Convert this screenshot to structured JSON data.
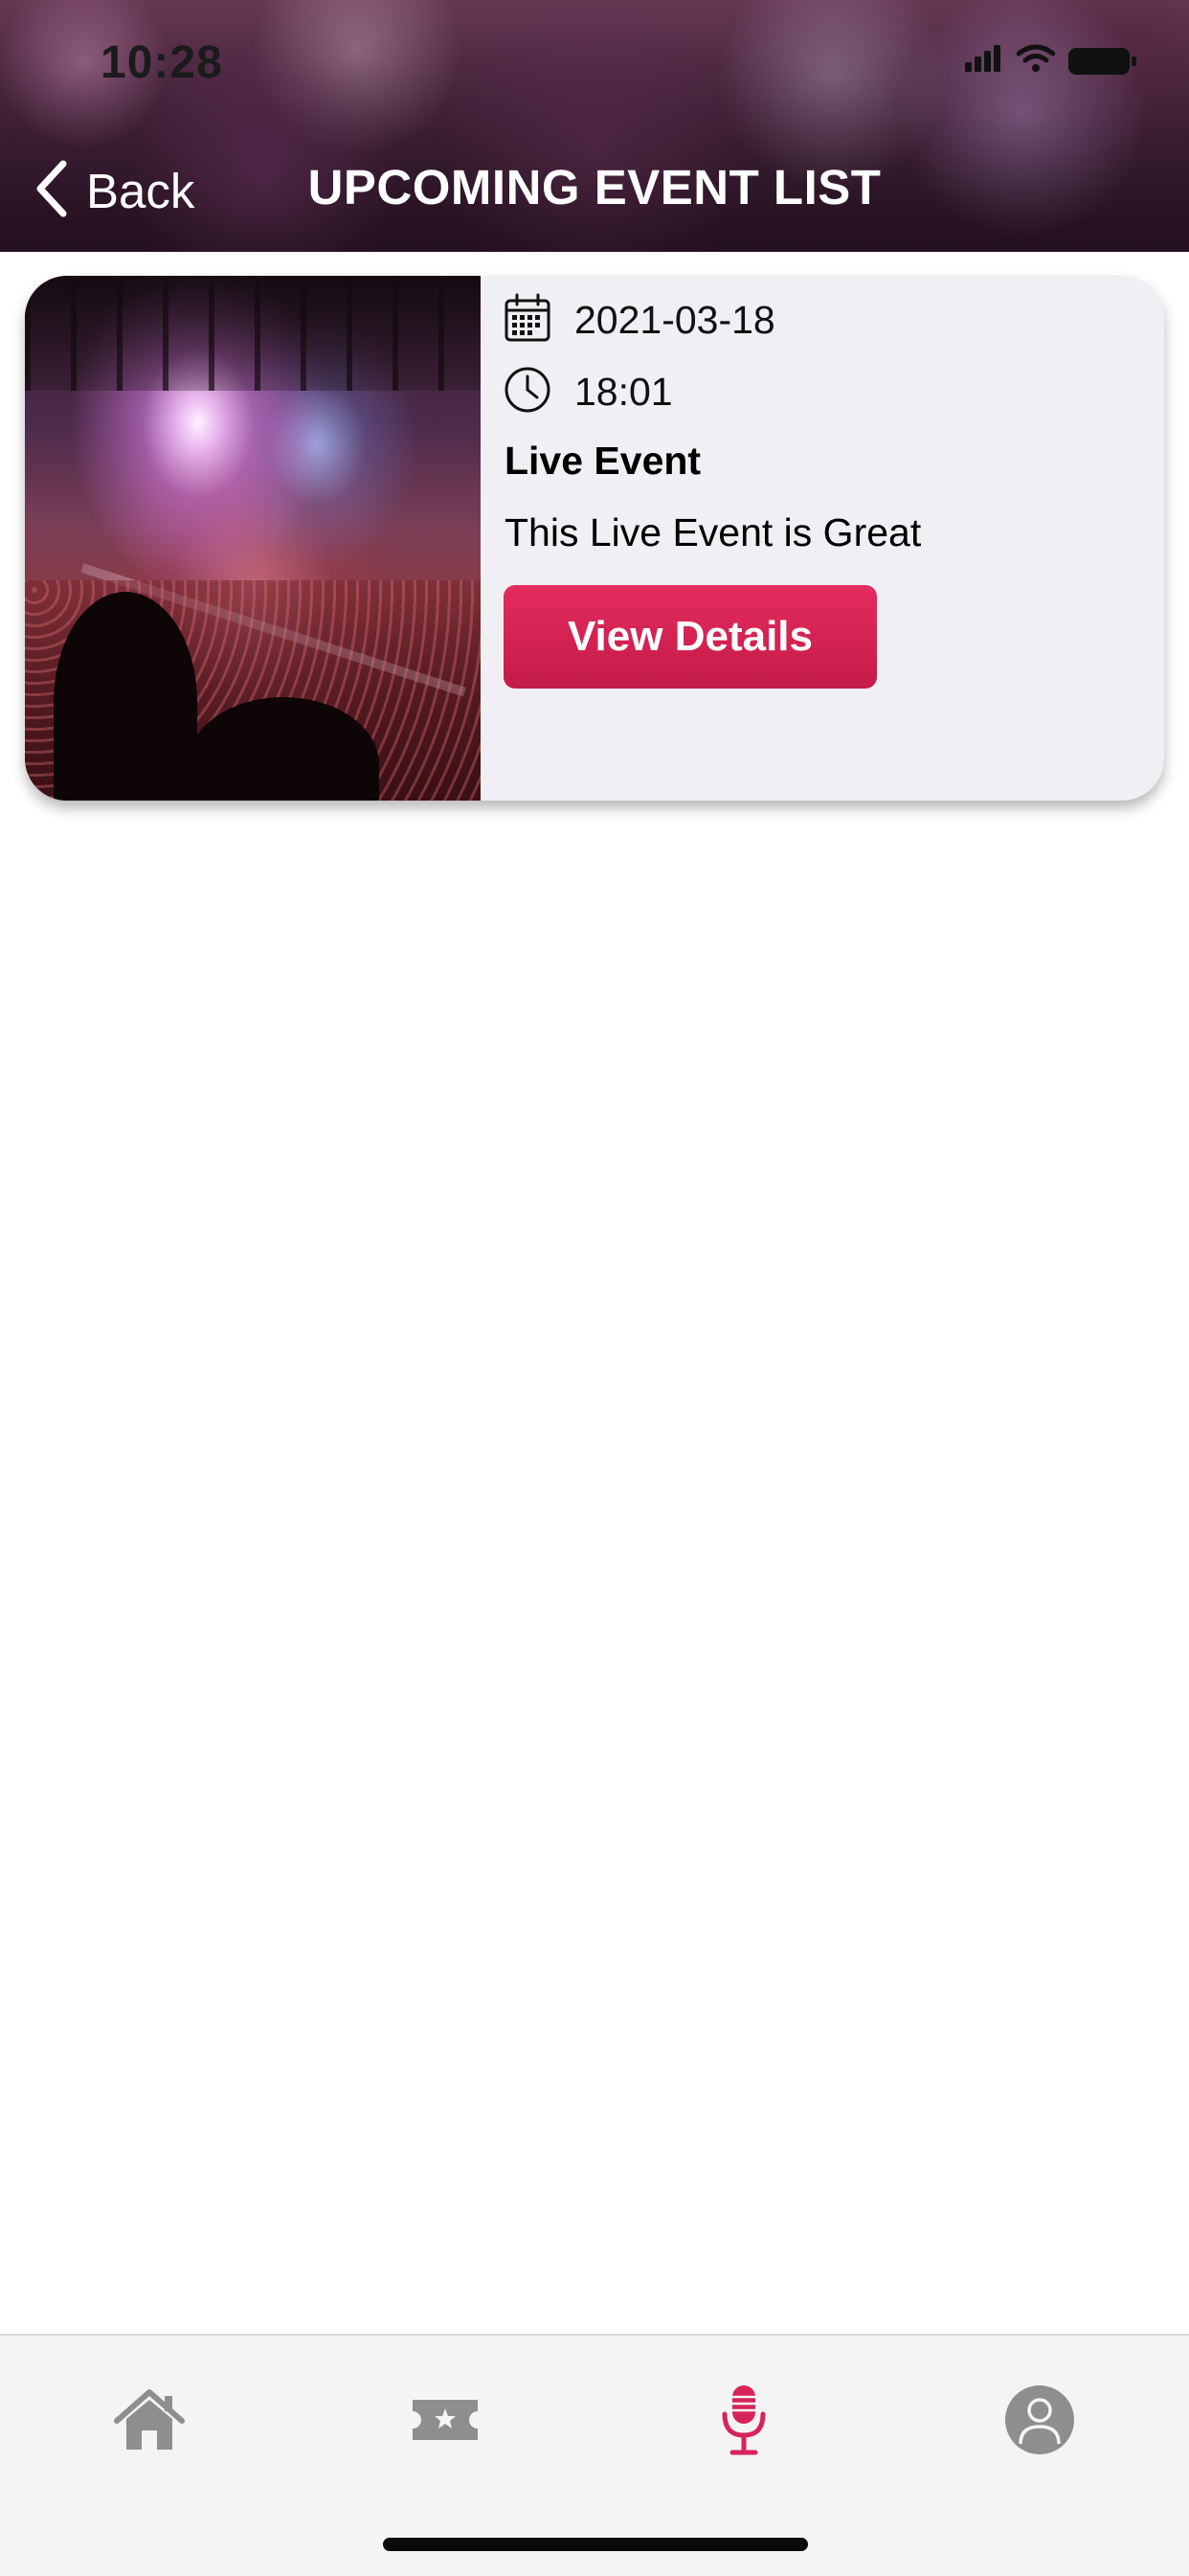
{
  "status_bar": {
    "time": "10:28"
  },
  "header": {
    "back_label": "Back",
    "title": "UPCOMING EVENT LIST"
  },
  "events": [
    {
      "date": "2021-03-18",
      "time": "18:01",
      "name": "Live Event",
      "description": "This Live Event is Great",
      "button_label": "View Details"
    }
  ],
  "tab_bar": {
    "items": [
      {
        "icon": "home-icon",
        "active": false
      },
      {
        "icon": "ticket-icon",
        "active": false
      },
      {
        "icon": "microphone-icon",
        "active": true
      },
      {
        "icon": "profile-icon",
        "active": false
      }
    ]
  },
  "colors": {
    "accent": "#d6245a",
    "tab_inactive": "#8e8e8e",
    "card_bg": "#f0eff4"
  }
}
